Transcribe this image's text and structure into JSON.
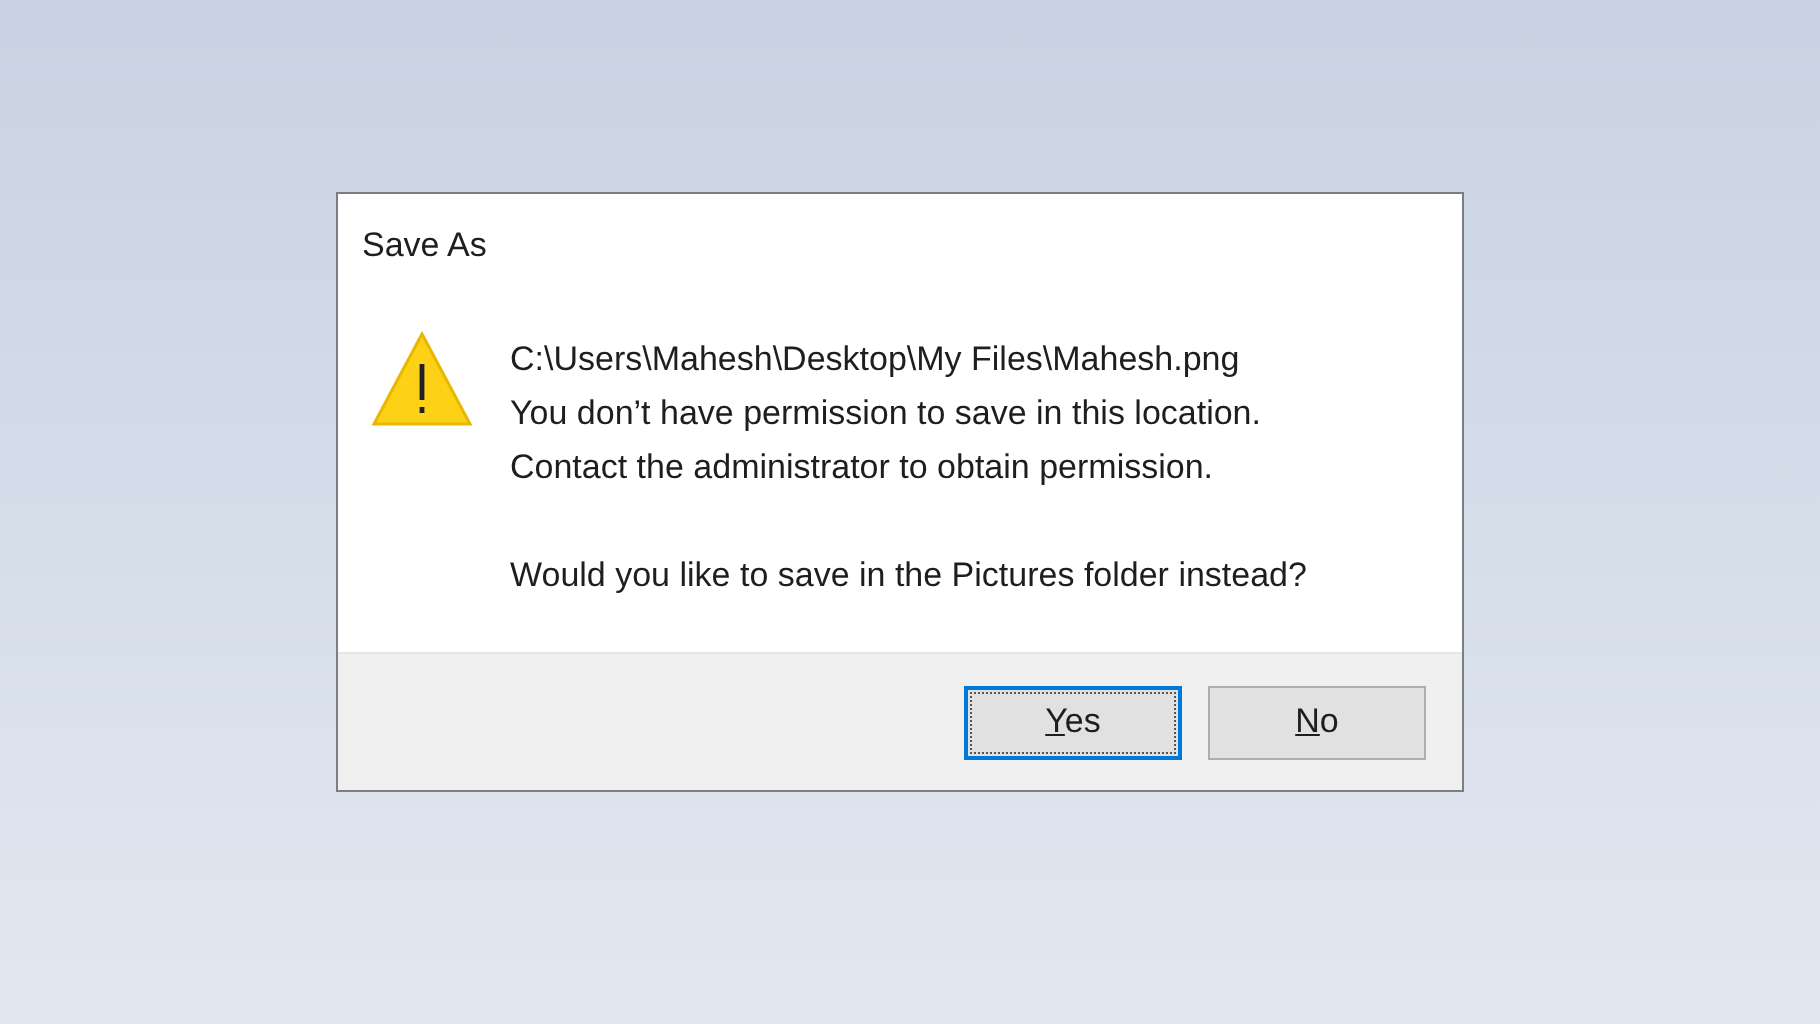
{
  "window": {
    "title": "Save As"
  },
  "message": {
    "lines": [
      "C:\\Users\\Mahesh\\Desktop\\My Files\\Mahesh.png",
      "You don’t have permission to save in this location.",
      "Contact the administrator to obtain permission."
    ],
    "question": "Would you like to save in the Pictures folder instead?"
  },
  "buttons": [
    {
      "label": "Yes",
      "focused": true,
      "mnemonic": true
    },
    {
      "label": "No",
      "focused": false,
      "mnemonic": true
    }
  ]
}
